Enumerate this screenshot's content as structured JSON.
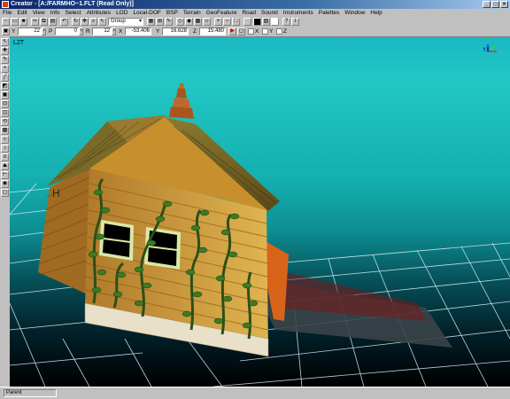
{
  "window": {
    "title": "Creator - [A:/FARMHO~1.FLT (Read Only)]",
    "buttons": [
      "_",
      "□",
      "×"
    ]
  },
  "menu": [
    "File",
    "Edit",
    "View",
    "Info",
    "Select",
    "Attributes",
    "LOD",
    "Local-DOF",
    "BSP",
    "Terrain",
    "GeoFeature",
    "Road",
    "Sound",
    "Instruments",
    "Palettes",
    "Window",
    "Help"
  ],
  "toolbar": {
    "mode_select": "Group"
  },
  "coords": {
    "y_label": "Y",
    "y_value": "22",
    "p_label": "P",
    "p_value": "0",
    "r_label": "R",
    "r_value": "12",
    "x_label": "X",
    "x_value": "-53.406",
    "y2_label": "Y",
    "y2_value": "16.628",
    "z_label": "Z",
    "z_value": "15.480",
    "axis_x": "X",
    "axis_y": "Y",
    "axis_z": "Z"
  },
  "viewport": {
    "title": "L2T",
    "axis_indicator": "YX"
  },
  "status": {
    "field": "Parent"
  },
  "colors": {
    "title_bar": "#0a246a",
    "sky_top": "#1ab8c4",
    "ground": "#000000",
    "grid": "#e0f4ff"
  }
}
